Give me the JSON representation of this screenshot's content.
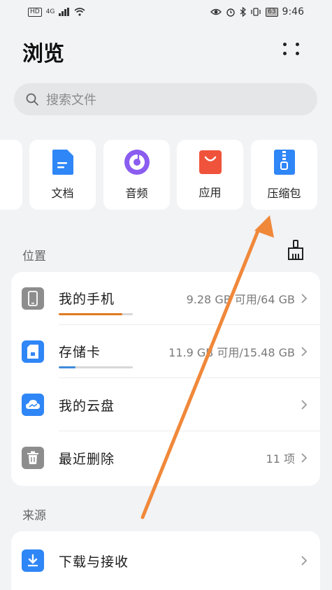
{
  "status_bar": {
    "hd": "HD",
    "network": "4G",
    "battery": "63",
    "time": "9:46"
  },
  "header": {
    "title": "浏览"
  },
  "search": {
    "placeholder": "搜索文件"
  },
  "categories": [
    {
      "label": "文档",
      "icon": "document-icon",
      "color": "#2f86f6"
    },
    {
      "label": "音频",
      "icon": "audio-icon",
      "color": "#8a5cf0"
    },
    {
      "label": "应用",
      "icon": "app-store-icon",
      "color": "#f0533c"
    },
    {
      "label": "压缩包",
      "icon": "zip-icon",
      "color": "#2f86f6"
    }
  ],
  "locations": {
    "section_label": "位置",
    "items": [
      {
        "title": "我的手机",
        "detail": "9.28 GB 可用/64 GB",
        "icon": "phone-icon",
        "usage": 0.86,
        "usage_color": "#e07a1f"
      },
      {
        "title": "存储卡",
        "detail": "11.9 GB 可用/15.48 GB",
        "icon": "sd-card-icon",
        "usage": 0.23,
        "usage_color": "#3d8bd9"
      },
      {
        "title": "我的云盘",
        "detail": "",
        "icon": "cloud-icon"
      },
      {
        "title": "最近删除",
        "detail": "11 项",
        "icon": "trash-icon"
      }
    ]
  },
  "sources": {
    "section_label": "来源",
    "items": [
      {
        "title": "下载与接收",
        "detail": "",
        "icon": "download-icon"
      }
    ]
  }
}
